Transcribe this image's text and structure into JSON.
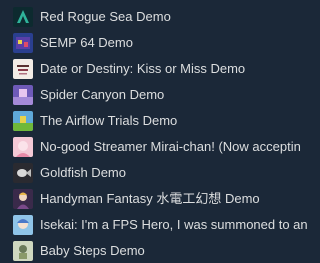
{
  "library": {
    "items": [
      {
        "label": "Red Rogue Sea Demo",
        "icon": "red-rogue-sea-icon"
      },
      {
        "label": "SEMP 64 Demo",
        "icon": "semp-64-icon"
      },
      {
        "label": "Date or Destiny: Kiss or Miss Demo",
        "icon": "date-or-destiny-icon"
      },
      {
        "label": "Spider Canyon Demo",
        "icon": "spider-canyon-icon"
      },
      {
        "label": "The Airflow Trials Demo",
        "icon": "airflow-trials-icon"
      },
      {
        "label": "No-good Streamer Mirai-chan! (Now acceptin",
        "icon": "mirai-chan-icon"
      },
      {
        "label": "Goldfish Demo",
        "icon": "goldfish-icon"
      },
      {
        "label": "Handyman Fantasy 水電工幻想 Demo",
        "icon": "handyman-fantasy-icon"
      },
      {
        "label": "Isekai: I'm a FPS Hero, I was summoned to an",
        "icon": "isekai-fps-hero-icon"
      },
      {
        "label": "Baby Steps Demo",
        "icon": "baby-steps-icon"
      }
    ]
  }
}
